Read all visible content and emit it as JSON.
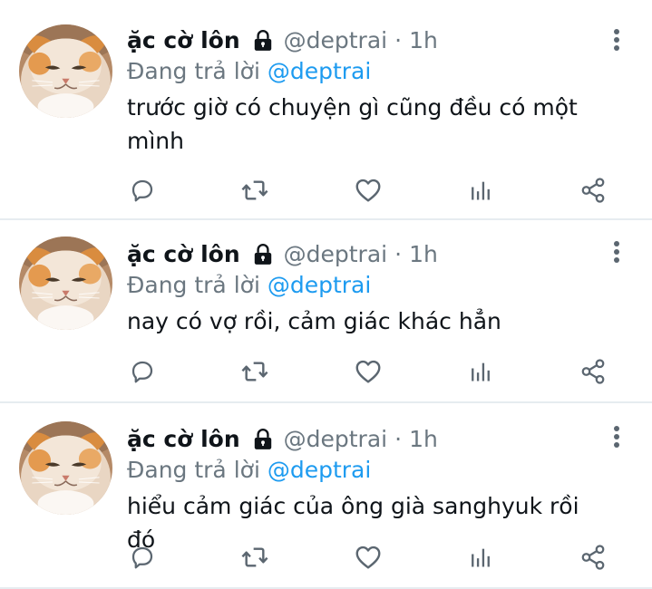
{
  "colors": {
    "link": "#1d9bf0",
    "secondary_text": "#6b7780",
    "icon": "#5b6670",
    "divider": "#e6ecf0"
  },
  "tweets": [
    {
      "display_name": "ặc cờ lôn",
      "handle": "@deptrai",
      "separator": "·",
      "time": "1h",
      "reply_prefix": "Đang trả lời",
      "reply_to": "@deptrai",
      "text": "trước giờ có chuyện gì cũng đều có một mình",
      "icons": [
        "lock-icon",
        "more-icon",
        "reply-icon",
        "retweet-icon",
        "like-icon",
        "analytics-icon",
        "share-icon"
      ]
    },
    {
      "display_name": "ặc cờ lôn",
      "handle": "@deptrai",
      "separator": "·",
      "time": "1h",
      "reply_prefix": "Đang trả lời",
      "reply_to": "@deptrai",
      "text": "nay có vợ rồi, cảm giác khác hẳn",
      "icons": [
        "lock-icon",
        "more-icon",
        "reply-icon",
        "retweet-icon",
        "like-icon",
        "analytics-icon",
        "share-icon"
      ]
    },
    {
      "display_name": "ặc cờ lôn",
      "handle": "@deptrai",
      "separator": "·",
      "time": "1h",
      "reply_prefix": "Đang trả lời",
      "reply_to": "@deptrai",
      "text": "hiểu cảm giác của ông già sanghyuk rồi đó",
      "icons": [
        "lock-icon",
        "more-icon",
        "reply-icon",
        "retweet-icon",
        "like-icon",
        "analytics-icon",
        "share-icon"
      ]
    }
  ]
}
